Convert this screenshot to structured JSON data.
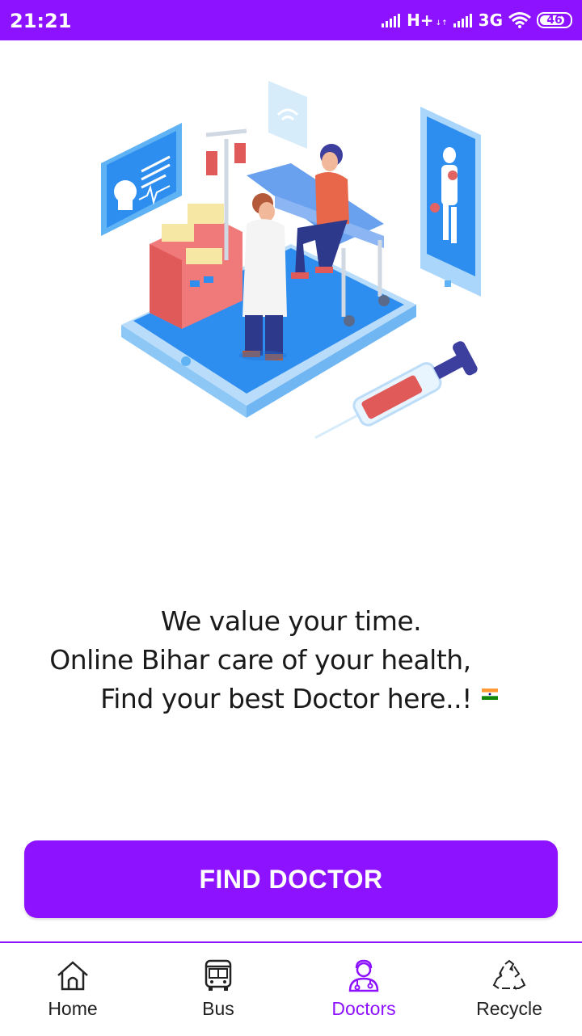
{
  "status_bar": {
    "time": "21:21",
    "network1": "H+",
    "network2": "3G",
    "battery": "46",
    "color": "#8d12ff"
  },
  "hero": {
    "illustration": "doctor-patient-clinic-illustration"
  },
  "tagline": {
    "line1": "We value your time.",
    "line2": "Online Bihar care of your health,",
    "line3": "Find your best Doctor here..!"
  },
  "actions": {
    "find_doctor_label": "FIND DOCTOR"
  },
  "bottom_nav": {
    "items": [
      {
        "label": "Home",
        "icon": "home-icon",
        "active": false
      },
      {
        "label": "Bus",
        "icon": "bus-icon",
        "active": false
      },
      {
        "label": "Doctors",
        "icon": "doctor-icon",
        "active": true
      },
      {
        "label": "Recycle",
        "icon": "recycle-icon",
        "active": false
      }
    ],
    "active_color": "#8d12ff"
  }
}
